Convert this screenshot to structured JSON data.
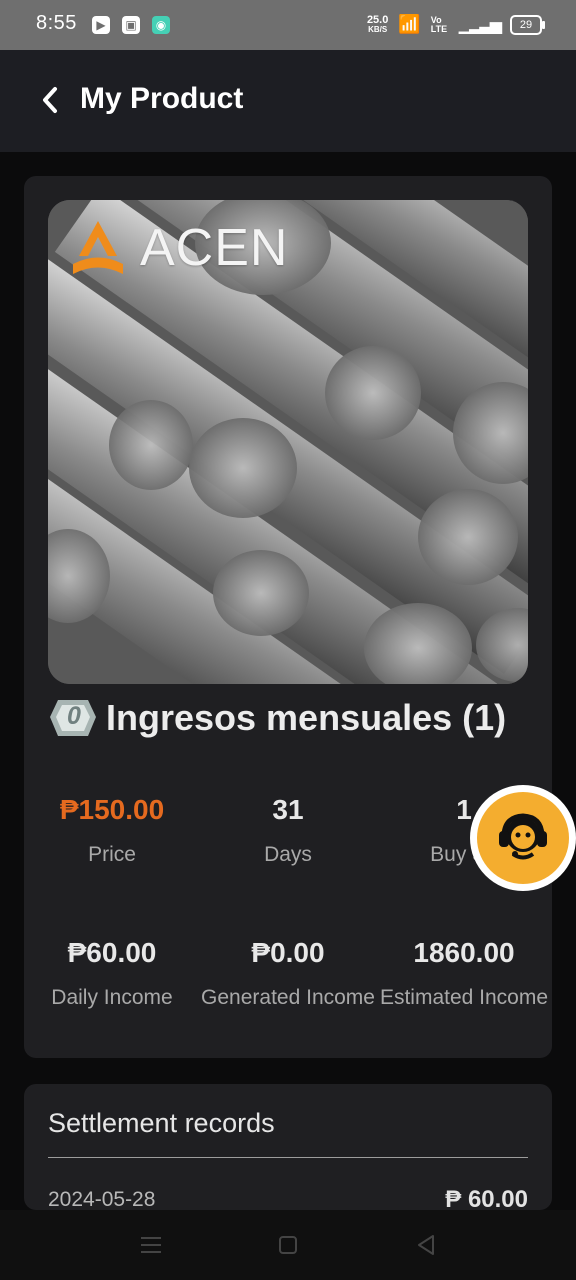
{
  "status_bar": {
    "time": "8:55",
    "netspeed_value": "25.0",
    "netspeed_unit": "KB/S",
    "lte_label": "Vo LTE",
    "battery": "29"
  },
  "header": {
    "title": "My Product"
  },
  "product": {
    "image_brand": "ACEN",
    "name": "Ingresos mensuales (1)",
    "badge_text": "0",
    "stats": [
      {
        "value": "₱150.00",
        "label": "Price"
      },
      {
        "value": "31",
        "label": "Days"
      },
      {
        "value": "1",
        "label": "Buy Sh"
      },
      {
        "value": "₱60.00",
        "label": "Daily Income"
      },
      {
        "value": "₱0.00",
        "label": "Generated Income"
      },
      {
        "value": "1860.00",
        "label": "Estimated Income"
      }
    ]
  },
  "settlement": {
    "title": "Settlement records",
    "records": [
      {
        "date": "2024-05-28",
        "amount": "₱ 60.00"
      }
    ]
  },
  "colors": {
    "accent_orange": "#e56a1f",
    "support_yellow": "#f4ad2f",
    "card_bg": "#1f1f22",
    "header_bg": "#1d1e23"
  },
  "icons": {
    "back": "chevron-left",
    "support": "headset-agent",
    "badge": "diamond-badge"
  }
}
